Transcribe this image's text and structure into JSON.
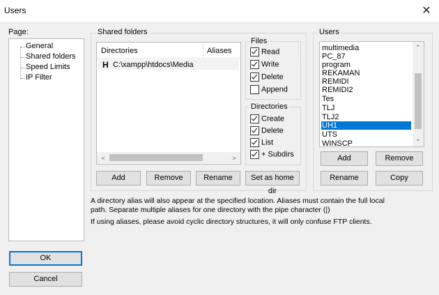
{
  "window": {
    "title": "Users",
    "close_glyph": "✕"
  },
  "page_group": {
    "label": "Page:",
    "items": [
      "General",
      "Shared folders",
      "Speed Limits",
      "IP Filter"
    ]
  },
  "shared_folders": {
    "label": "Shared folders",
    "columns": [
      "Directories",
      "Aliases"
    ],
    "rows": [
      {
        "marker": "H",
        "path": "C:\\xampp\\htdocs\\Media",
        "alias": ""
      }
    ],
    "buttons": {
      "add": "Add",
      "remove": "Remove",
      "rename": "Rename",
      "set_home": "Set as home dir"
    }
  },
  "files_group": {
    "label": "Files",
    "items": [
      {
        "label": "Read",
        "checked": true
      },
      {
        "label": "Write",
        "checked": true
      },
      {
        "label": "Delete",
        "checked": true
      },
      {
        "label": "Append",
        "checked": false
      }
    ]
  },
  "directories_group": {
    "label": "Directories",
    "items": [
      {
        "label": "Create",
        "checked": true
      },
      {
        "label": "Delete",
        "checked": true
      },
      {
        "label": "List",
        "checked": true
      },
      {
        "label": "+ Subdirs",
        "checked": true
      }
    ]
  },
  "users_group": {
    "label": "Users",
    "items": [
      "multimedia",
      "PC_87",
      "program",
      "REKAMAN",
      "REMIDI",
      "REMIDI2",
      "Tes",
      "TLJ",
      "TLJ2",
      "UH1",
      "UTS",
      "WINSCP"
    ],
    "selected": "UH1",
    "buttons": {
      "add": "Add",
      "remove": "Remove",
      "rename": "Rename",
      "copy": "Copy"
    }
  },
  "info": {
    "line1": "A directory alias will also appear at the specified location. Aliases must contain the full local",
    "line2": "path. Separate multiple aliases for one directory with the pipe character (|)",
    "line3": "If using aliases, please avoid cyclic directory structures, it will only confuse FTP clients."
  },
  "dialog_buttons": {
    "ok": "OK",
    "cancel": "Cancel"
  },
  "colors": {
    "selection": "#0078d7",
    "accent_border": "#0078d7"
  }
}
